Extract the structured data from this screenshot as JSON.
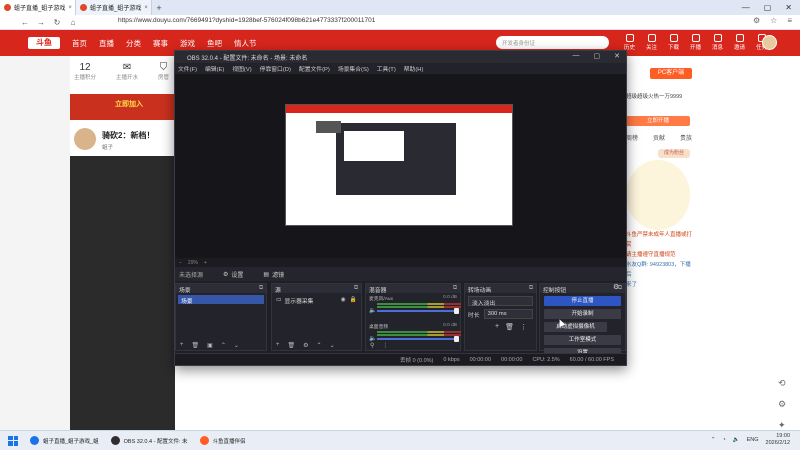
{
  "browser": {
    "tabs": [
      {
        "label": "蛆子直播_蛆子游戏",
        "active": true
      },
      {
        "label": "蛆子直播_蛆子游戏",
        "active": false
      }
    ],
    "url": "https://www.douyu.com/7669491?dyshid=1928bef-576024f098b621e4773337f200011701"
  },
  "douyu": {
    "logo": "斗鱼",
    "nav": [
      "首页",
      "直播",
      "分类",
      "赛事",
      "游戏",
      "鱼吧",
      "情人节"
    ],
    "search_placeholder": "开发者身份证",
    "header_icons": [
      "历史",
      "关注",
      "下载",
      "开播",
      "消息",
      "邀请",
      "任务"
    ],
    "stats": [
      {
        "num": "12",
        "label": "主播积分"
      },
      {
        "num": "",
        "label": "主播开水"
      },
      {
        "num": "",
        "label": "房管"
      }
    ],
    "banner": "立即加入",
    "streamer_name": "骑砍2：新档！",
    "streamer_tag": "蛆子",
    "pc_button": "PC客户端",
    "anchor_card": "超级超级火热一万9999",
    "subscribe": "立即开播",
    "right_tabs": [
      "周榜",
      "贡献",
      "贵族"
    ],
    "fan_badge": "成为粉丝",
    "chat_lines": [
      "斗鱼严禁未成年人直播或打赏",
      "请主播遵守直播规范",
      "水友Q群: 94923803，下播后",
      "来了"
    ]
  },
  "obs": {
    "title": "OBS 32.0.4 - 配置文件: 未命名 - 场景: 未命名",
    "menu": [
      "文件(F)",
      "编辑(E)",
      "视图(V)",
      "停靠窗口(D)",
      "配置文件(P)",
      "场景集合(S)",
      "工具(T)",
      "帮助(H)"
    ],
    "zoom": "29%",
    "no_source": "未选择源",
    "props_btn": "设置",
    "filters_btn": "滤镜",
    "docks": {
      "scenes": {
        "title": "场景",
        "items": [
          "场景"
        ]
      },
      "sources": {
        "title": "源",
        "items": [
          "显示器采集"
        ]
      },
      "mixer": {
        "title": "混音器",
        "channels": [
          {
            "name": "麦克风/Aux",
            "db": "0.0 dB"
          },
          {
            "name": "桌面音频",
            "db": "0.0 dB"
          }
        ]
      },
      "transitions": {
        "title": "转场动画",
        "type": "淡入淡出",
        "duration_label": "时长",
        "duration": "300 ms"
      },
      "controls": {
        "title": "控制按钮",
        "buttons": [
          "停止直播",
          "开始录制",
          "启动虚拟摄像机",
          "工作室模式",
          "设置"
        ]
      }
    },
    "status": [
      "丢帧 0 (0.0%)",
      "0 kbps",
      "00:00:00",
      "00:00:00",
      "CPU: 2.5%",
      "60.00 / 60.00 FPS"
    ]
  },
  "taskbar": {
    "apps": [
      "蛆子直播_蛆子游戏_蛆",
      "OBS 32.0.4 - 配置文件: 未",
      "斗鱼直播伴侣"
    ],
    "lang": "ENG",
    "time": "19:00",
    "date": "2026/2/12"
  },
  "colors": {
    "douyu_red": "#d7261c",
    "obs_bg": "#1f1f26",
    "obs_accent": "#2d56c4"
  }
}
